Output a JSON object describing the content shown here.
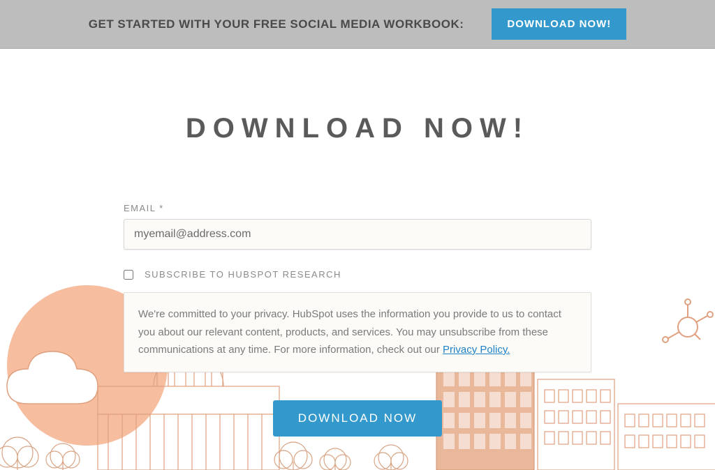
{
  "banner": {
    "text": "GET STARTED WITH YOUR FREE SOCIAL MEDIA WORKBOOK:",
    "button_label": "DOWNLOAD NOW!"
  },
  "heading": "DOWNLOAD NOW!",
  "form": {
    "email_label": "EMAIL *",
    "email_value": "myemail@address.com",
    "subscribe_label": "SUBSCRIBE TO HUBSPOT RESEARCH",
    "privacy_text": "We're committed to your privacy. HubSpot uses the information you provide to us to contact you about our relevant content, products, and services. You may unsubscribe from these communications at any time. For more information, check out our ",
    "privacy_link_text": "Privacy Policy.",
    "submit_label": "DOWNLOAD NOW"
  }
}
